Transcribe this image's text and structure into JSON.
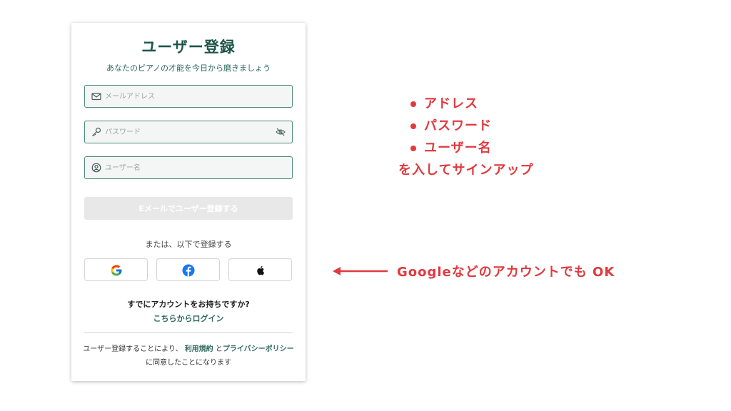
{
  "form": {
    "title": "ユーザー登録",
    "subtitle": "あなたのピアノの才能を今日から磨きましょう",
    "email": {
      "placeholder": "メールアドレス",
      "value": "",
      "icon": "mail-icon"
    },
    "password": {
      "placeholder": "パスワード",
      "value": "",
      "icon": "key-icon",
      "toggle_icon": "eye-off-icon"
    },
    "username": {
      "placeholder": "ユーザー名",
      "value": "",
      "icon": "user-circle-icon"
    },
    "submit_label": "Eメールでユーザー登録する",
    "or_text": "または、以下で登録する",
    "social": [
      {
        "provider": "google",
        "icon": "google-icon"
      },
      {
        "provider": "facebook",
        "icon": "facebook-icon"
      },
      {
        "provider": "apple",
        "icon": "apple-icon"
      }
    ],
    "have_account": "すでにアカウントをお持ちですか?",
    "login_link": "こちらからログイン",
    "terms": {
      "prefix": "ユーザー登録することにより、",
      "terms_link": "利用規約",
      "connector": "と",
      "privacy_link": "プライバシーポリシー",
      "suffix": "に同意したことになります"
    }
  },
  "annotations": {
    "bullets": [
      "アドレス",
      "パスワード",
      "ユーザー名"
    ],
    "bullets_tail": "を入してサインアップ",
    "social_note": "Googleなどのアカウントでも OK"
  },
  "colors": {
    "brand_green": "#1e5548",
    "field_border": "#4d8a7a",
    "disabled_button": "#e8e8e8",
    "annotation_red": "#e0393e"
  }
}
